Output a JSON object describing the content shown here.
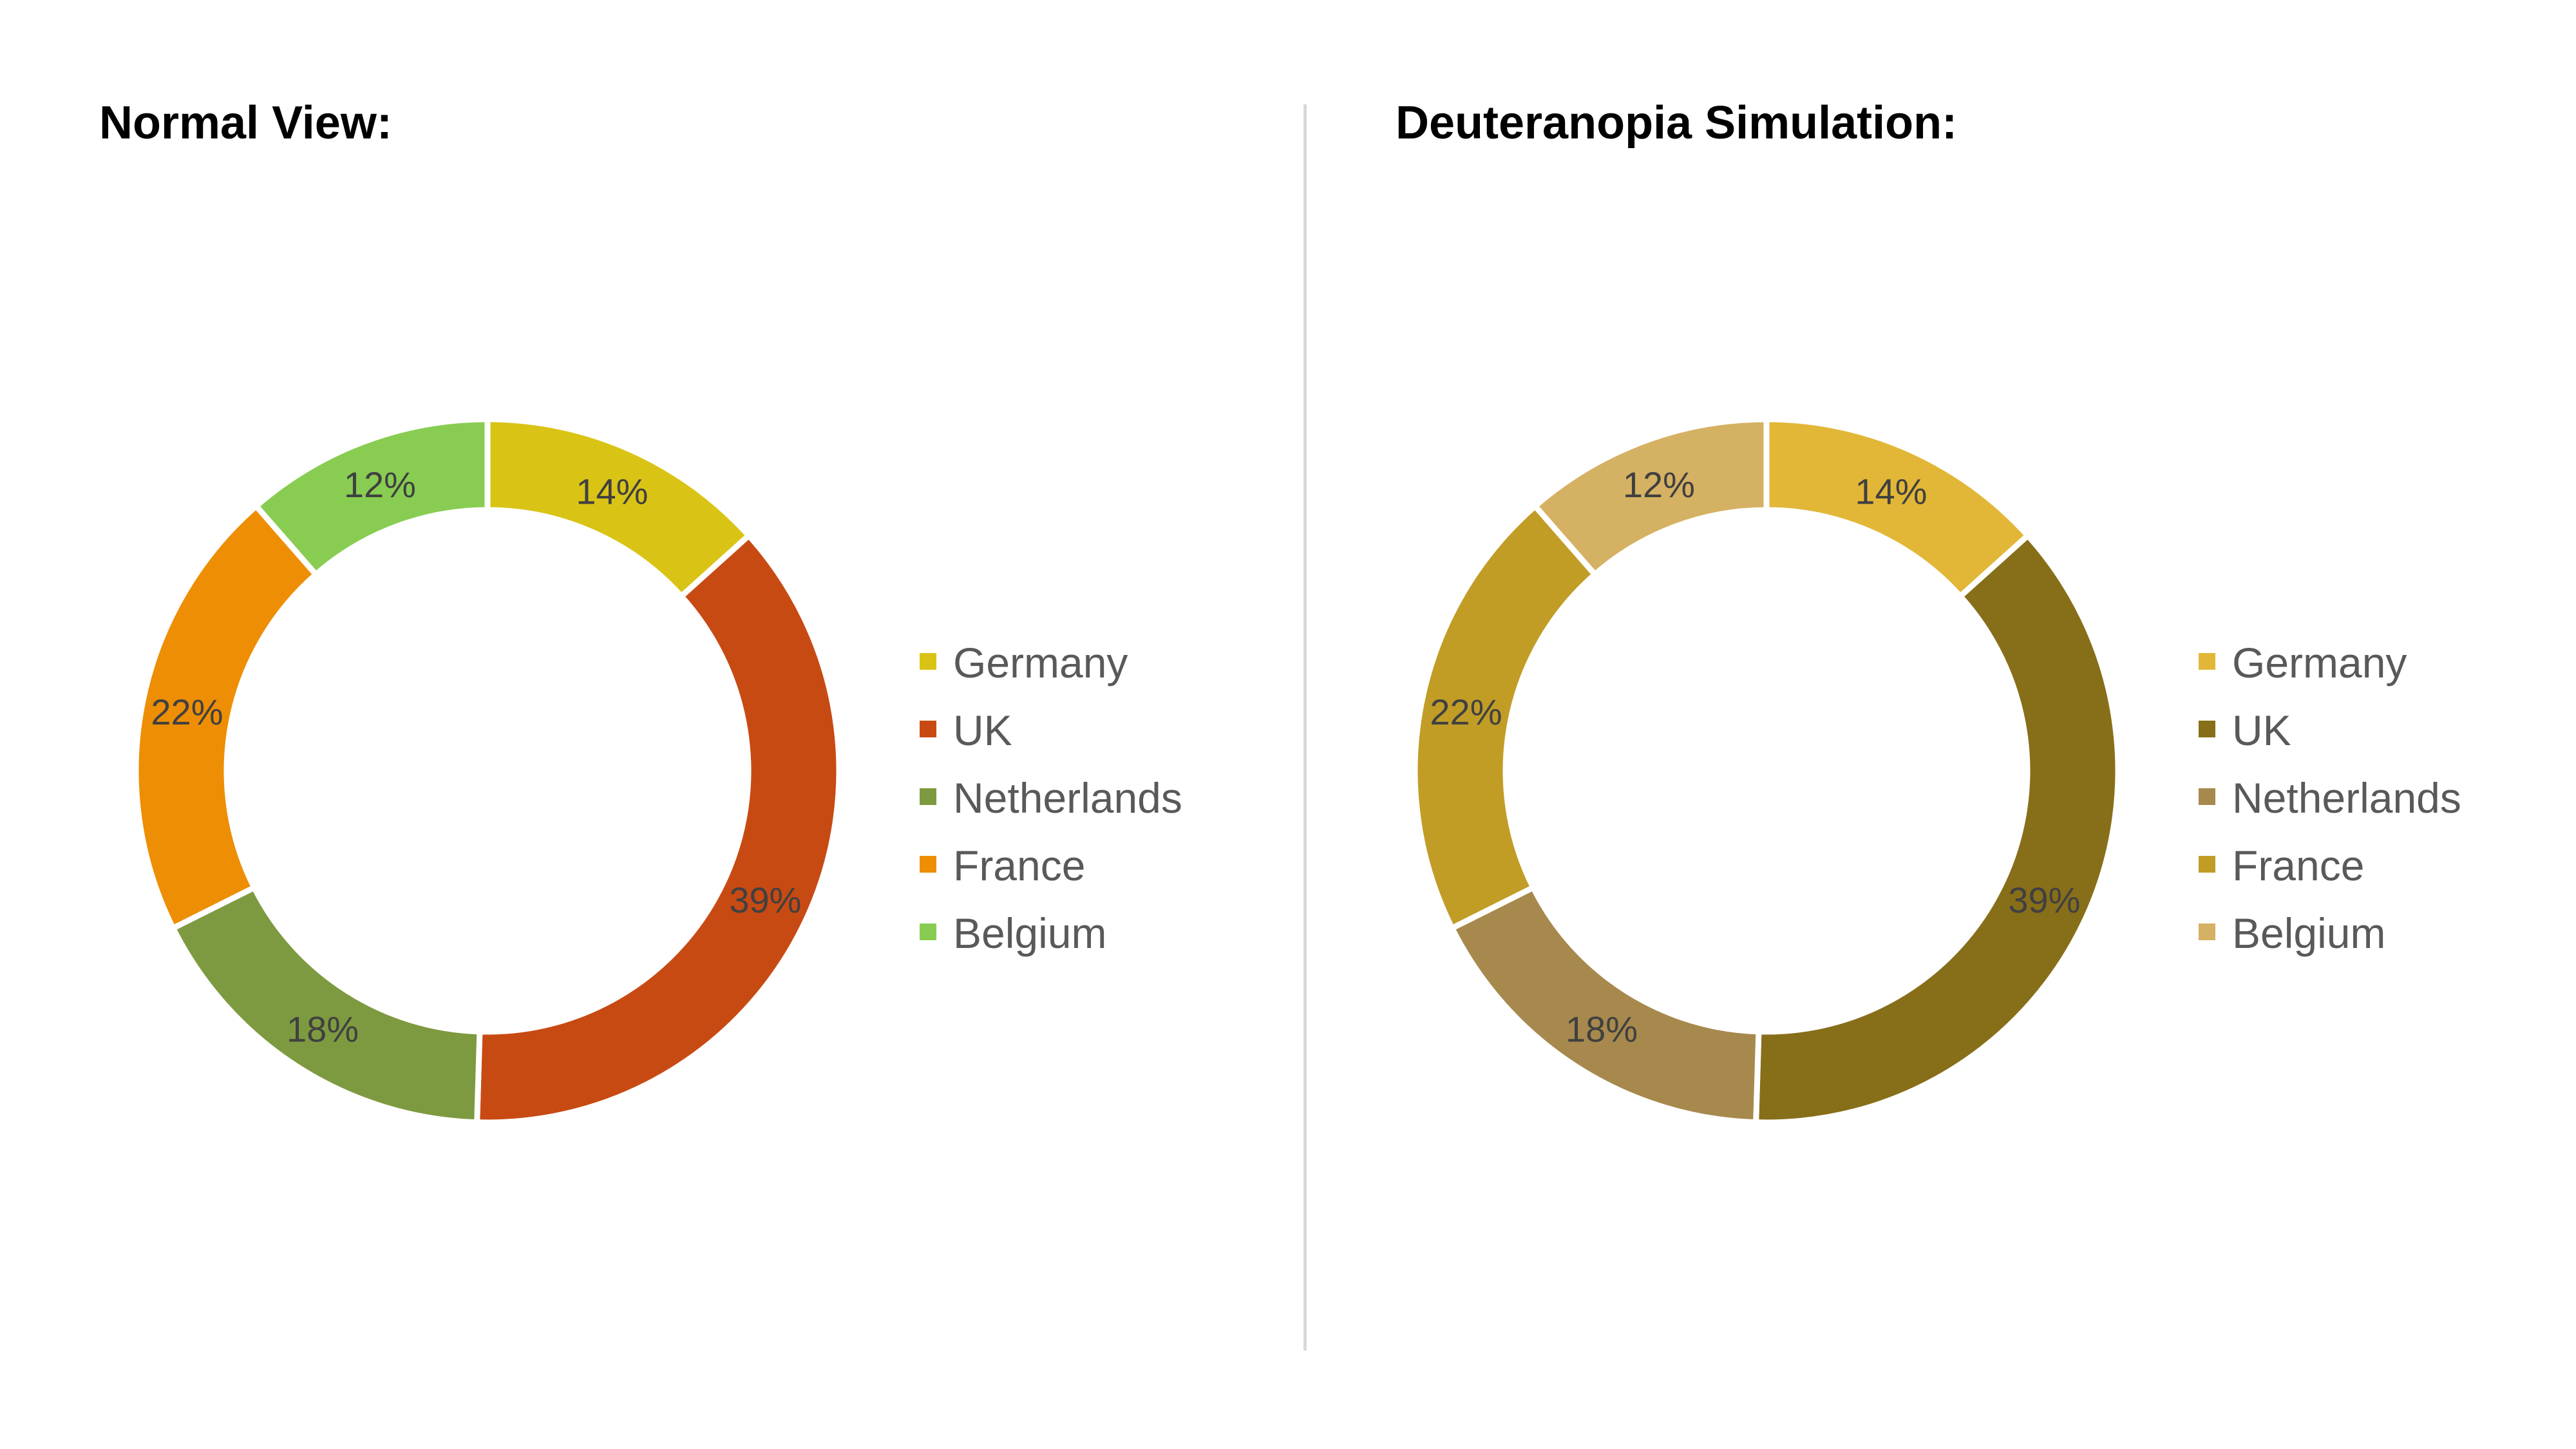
{
  "chart_data": [
    {
      "type": "pie",
      "variant": "donut",
      "title": "Normal View:",
      "categories": [
        "Germany",
        "UK",
        "Netherlands",
        "France",
        "Belgium"
      ],
      "values": [
        14,
        39,
        18,
        22,
        12
      ],
      "data_labels": [
        "14%",
        "39%",
        "18%",
        "22%",
        "12%"
      ],
      "colors": [
        "#D9C416",
        "#C84A13",
        "#7E9A40",
        "#EE8E04",
        "#88CD52"
      ],
      "legend_placement": "right"
    },
    {
      "type": "pie",
      "variant": "donut",
      "title": "Deuteranopia Simulation:",
      "categories": [
        "Germany",
        "UK",
        "Netherlands",
        "France",
        "Belgium"
      ],
      "values": [
        14,
        39,
        18,
        22,
        12
      ],
      "data_labels": [
        "14%",
        "39%",
        "18%",
        "22%",
        "12%"
      ],
      "colors": [
        "#E2B737",
        "#876E19",
        "#A7894D",
        "#C19D26",
        "#D5B163"
      ],
      "legend_placement": "right"
    }
  ]
}
